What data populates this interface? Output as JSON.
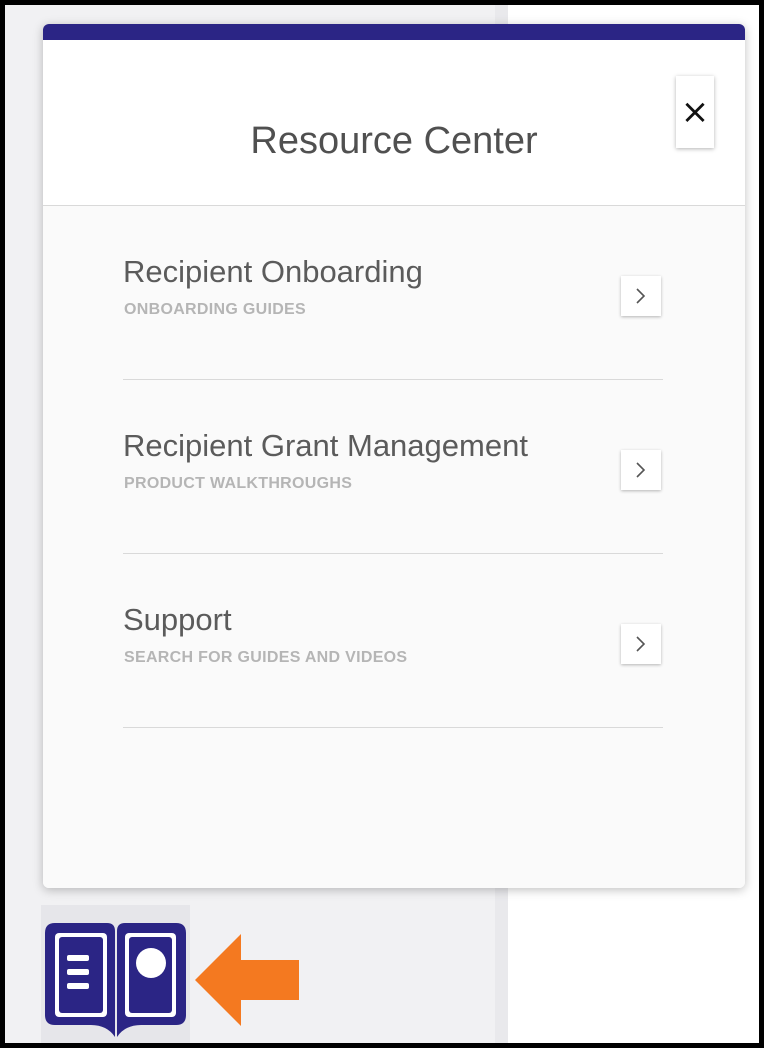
{
  "resource_center": {
    "title": "Resource Center",
    "close_label": "×",
    "items": [
      {
        "title": "Recipient Onboarding",
        "subtitle": "ONBOARDING GUIDES"
      },
      {
        "title": "Recipient Grant Management",
        "subtitle": "PRODUCT WALKTHROUGHS"
      },
      {
        "title": "Support",
        "subtitle": "SEARCH FOR GUIDES AND VIDEOS"
      }
    ]
  },
  "icons": {
    "chevron": "chevron-right-icon",
    "launcher": "open-book-icon",
    "pointer": "arrow-left-icon"
  },
  "colors": {
    "accent": "#2b2585",
    "pointer_arrow": "#f47920",
    "title_text": "#505050",
    "subtitle_text": "#b5b5b5"
  }
}
